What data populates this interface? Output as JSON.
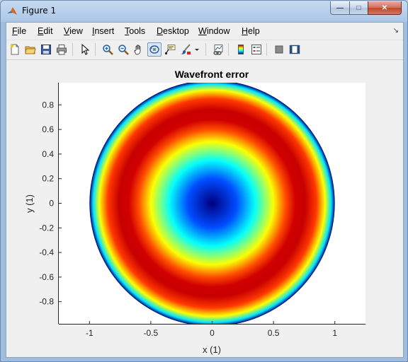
{
  "window": {
    "title": "Figure 1",
    "controls": {
      "minimize": "—",
      "maximize": "□",
      "close": "✕"
    }
  },
  "menu": {
    "items": [
      "File",
      "Edit",
      "View",
      "Insert",
      "Tools",
      "Desktop",
      "Window",
      "Help"
    ],
    "overflow_icon": "dock-arrow-icon"
  },
  "toolbar": {
    "buttons": [
      "new-figure-icon",
      "open-file-icon",
      "save-icon",
      "print-icon",
      "edit-plot-arrow-icon",
      "zoom-in-icon",
      "zoom-out-icon",
      "pan-hand-icon",
      "rotate-3d-icon",
      "data-cursor-icon",
      "brush-icon",
      "link-plot-icon",
      "insert-colorbar-icon",
      "insert-legend-icon",
      "hide-plot-tools-icon",
      "show-plot-tools-icon"
    ],
    "pressed": "rotate-3d-icon"
  },
  "chart_data": {
    "type": "heatmap",
    "title": "Wavefront error",
    "xlabel": "x (1)",
    "ylabel": "y (1)",
    "xlim": [
      -1.25,
      1.25
    ],
    "ylim": [
      -0.98,
      0.98
    ],
    "x_ticks": [
      -1,
      -0.5,
      0,
      0.5,
      1
    ],
    "x_tick_labels": [
      "-1",
      "-0.5",
      "0",
      "0.5",
      "1"
    ],
    "y_ticks": [
      0.8,
      0.6,
      0.4,
      0.2,
      0,
      -0.2,
      -0.4,
      -0.6,
      -0.8
    ],
    "y_tick_labels": [
      "0.8",
      "0.6",
      "0.4",
      "0.2",
      "0",
      "-0.2",
      "-0.4",
      "-0.6",
      "-0.8"
    ],
    "aperture_radius": 1,
    "colormap": "jet",
    "radial_profile": {
      "r": [
        0,
        0.2,
        0.35,
        0.5,
        0.6,
        0.68,
        0.76,
        0.85,
        0.92,
        0.97,
        1.0
      ],
      "normalized_value": [
        0.0,
        0.2,
        0.38,
        0.62,
        0.8,
        0.92,
        0.93,
        0.82,
        0.62,
        0.35,
        0.0
      ]
    },
    "grid": false
  }
}
